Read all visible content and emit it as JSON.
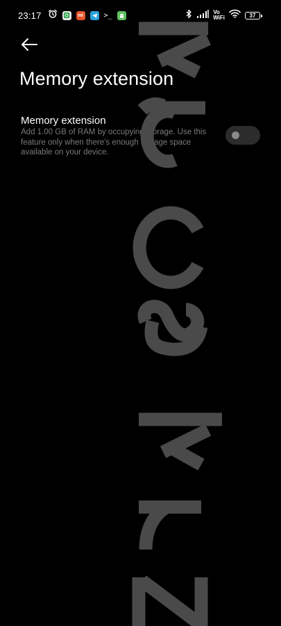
{
  "status_bar": {
    "time": "23:17",
    "notification_icons": [
      "alarm-icon",
      "whatsapp-icon",
      "mi-icon",
      "telegram-icon",
      "terminal-icon",
      "android-icon"
    ],
    "mi_badge_text": "mi",
    "terminal_glyph": ">_",
    "vowifi_top": "Vo",
    "vowifi_bottom": "WiFi",
    "battery_level": "37"
  },
  "header": {
    "back_icon": "back-arrow-icon",
    "title": "Memory extension"
  },
  "setting": {
    "title": "Memory extension",
    "description": "Add 1.00 GB of RAM by occupying storage. Use this feature only when there's enough storage space available on your device.",
    "toggle_on": false
  },
  "watermark": {
    "text": "kacskrz"
  },
  "colors": {
    "background": "#000000",
    "text_primary": "#ffffff",
    "text_secondary": "#7a7a7a",
    "toggle_track": "#2c2c2c",
    "toggle_knob": "#8a8a8a",
    "watermark": "#4a4a4a"
  }
}
